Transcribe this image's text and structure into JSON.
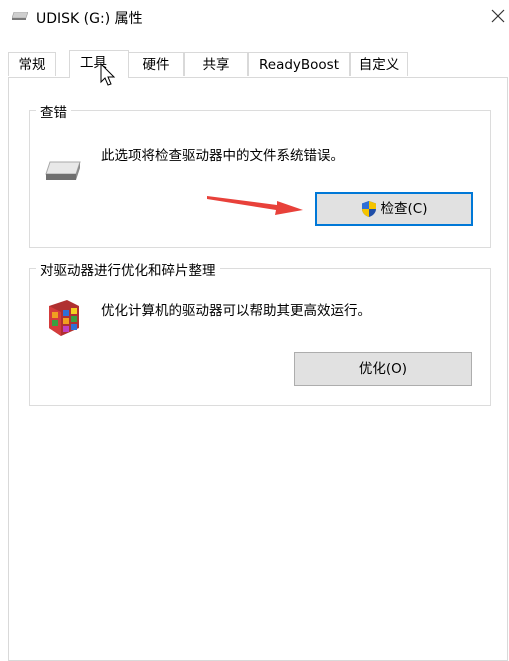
{
  "window": {
    "title": "UDISK (G:) 属性"
  },
  "tabs": [
    {
      "label": "常规"
    },
    {
      "label": "工具"
    },
    {
      "label": "硬件"
    },
    {
      "label": "共享"
    },
    {
      "label": "ReadyBoost"
    },
    {
      "label": "自定义"
    }
  ],
  "active_tab": "工具",
  "error_check": {
    "group_title": "查错",
    "description": "此选项将检查驱动器中的文件系统错误。",
    "button_label": "检查(C)"
  },
  "optimize": {
    "group_title": "对驱动器进行优化和碎片整理",
    "description": "优化计算机的驱动器可以帮助其更高效运行。",
    "button_label": "优化(O)"
  },
  "colors": {
    "accent": "#0078d7",
    "arrow": "#e8413a",
    "button_bg": "#e1e1e1"
  }
}
